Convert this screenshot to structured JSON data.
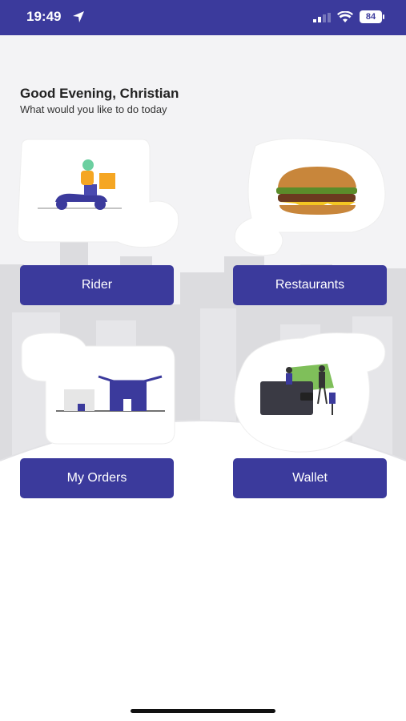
{
  "status_bar": {
    "time": "19:49",
    "battery": "84"
  },
  "greeting": {
    "title": "Good Evening, Christian",
    "subtitle": "What would you like to do today"
  },
  "menu": {
    "rider": "Rider",
    "restaurants": "Restaurants",
    "my_orders": "My Orders",
    "wallet": "Wallet"
  },
  "colors": {
    "primary": "#3b3a9c",
    "accent": "#f5a623",
    "background": "#f3f3f5"
  },
  "icons": {
    "rider": "scooter-delivery-icon",
    "restaurants": "burger-icon",
    "my_orders": "warehouse-boxes-icon",
    "wallet": "wallet-money-icon"
  }
}
